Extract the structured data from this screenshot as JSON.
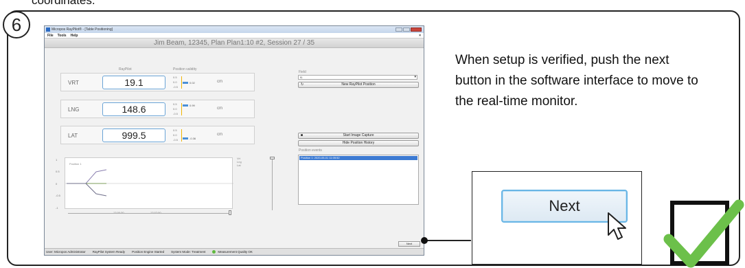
{
  "top_text": "coordinates.",
  "step_number": "6",
  "app": {
    "window_title": "Micropos RayPilot® - [Table Positioning]",
    "menu": [
      "File",
      "Tools",
      "Help"
    ],
    "menu_close": "×",
    "header": "Jim Beam, 12345, Plan Plan1:10 #2, Session 27 / 35",
    "col_raypilot": "RayPilot",
    "col_validity": "Position validity",
    "rows": [
      {
        "label": "VRT",
        "value": "19.1",
        "validity": "0.02",
        "unit": "cm"
      },
      {
        "label": "LNG",
        "value": "148.6",
        "validity": "0.99",
        "unit": "cm"
      },
      {
        "label": "LAT",
        "value": "999.5",
        "validity": "-0.36",
        "unit": "cm"
      }
    ],
    "validity_ticks": [
      "0.5",
      "0.0",
      "-0.5"
    ],
    "field_label": "Field",
    "field_value": "f1",
    "new_position_button": "New RayPilot Position",
    "start_capture_button": "Start Image Capture",
    "hide_history_button": "Hide Position History",
    "position_events_label": "Position events",
    "position_event_row": "Position 1: 2020-05-01 11:05:52",
    "chart": {
      "series_label": "Position 1",
      "y_ticks": [
        "1",
        "0.5",
        "0",
        "-0.5",
        "-1"
      ],
      "x_ticks": [
        "17:00:30",
        "17:07:00"
      ],
      "legend": [
        "Vrt",
        "Lng",
        "Lat"
      ]
    },
    "next_button": "Next",
    "status": {
      "user": "User: Micropos Administrator",
      "system": "RayPilot System Ready",
      "engine": "Position Engine Started",
      "mode": "System Mode: Treatment",
      "quality": "Measurement Quality OK"
    }
  },
  "instruction": "When setup is verified, push the next button in the software interface to move to the real-time monitor.",
  "zoom_next_button": "Next",
  "colors": {
    "accent_blue": "#68b5e5",
    "check_green": "#6cc04a"
  },
  "icons": [
    "cursor-icon",
    "checkmark-icon",
    "camera-icon",
    "refresh-icon"
  ]
}
